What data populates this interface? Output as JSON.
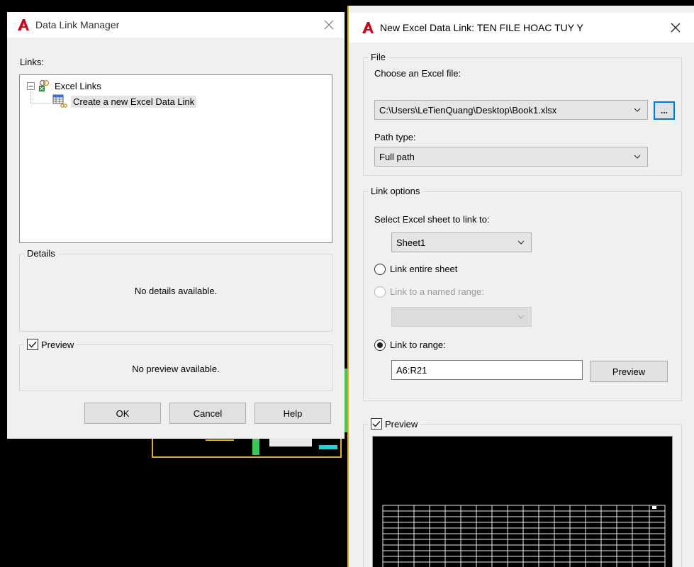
{
  "colors": {
    "accent": "#0078d7",
    "autocad_red": "#d0021b",
    "cad_yellow": "#e0b020"
  },
  "data_link_manager": {
    "title": "Data Link Manager",
    "links_label": "Links:",
    "tree": {
      "root": "Excel Links",
      "child": "Create a new Excel Data Link"
    },
    "details": {
      "title": "Details",
      "message": "No details available."
    },
    "preview": {
      "label": "Preview",
      "checked": true,
      "message": "No preview available."
    },
    "buttons": {
      "ok": "OK",
      "cancel": "Cancel",
      "help": "Help"
    }
  },
  "new_excel_link": {
    "title": "New Excel Data Link: TEN FILE HOAC TUY Y",
    "file_group": {
      "title": "File",
      "choose_label": "Choose an Excel file:",
      "file_path": "C:\\Users\\LeTienQuang\\Desktop\\Book1.xlsx",
      "browse_label": "...",
      "path_type_label": "Path type:",
      "path_type_value": "Full path"
    },
    "link_options": {
      "title": "Link options",
      "sheet_label": "Select Excel sheet to link to:",
      "sheet_value": "Sheet1",
      "option_entire": "Link entire sheet",
      "option_named": "Link to a named range:",
      "named_range_value": "",
      "option_range": "Link to range:",
      "range_value": "A6:R21",
      "preview_button": "Preview",
      "selected_option": "range"
    },
    "preview": {
      "label": "Preview",
      "checked": true
    }
  }
}
